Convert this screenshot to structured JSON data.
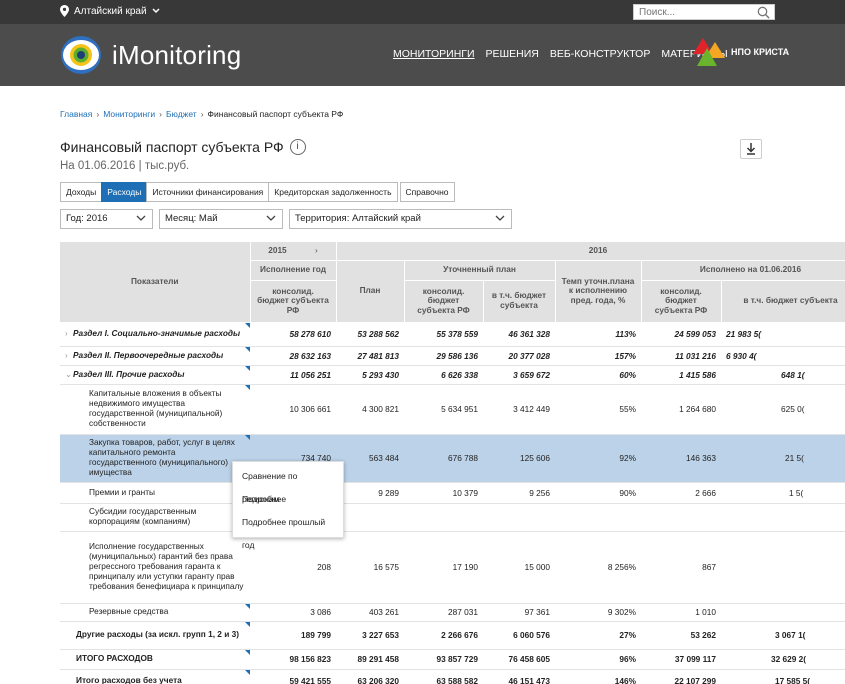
{
  "topbar": {
    "region": "Алтайский край",
    "search_placeholder": "Поиск..."
  },
  "header": {
    "brand": "iMonitoring",
    "nav": [
      "МОНИТОРИНГИ",
      "РЕШЕНИЯ",
      "ВЕБ-КОНСТРУКТОР",
      "МАТЕРИАЛЫ"
    ],
    "partner": "НПО КРИСТА"
  },
  "breadcrumb": [
    "Главная",
    "Мониторинги",
    "Бюджет",
    "Финансовый паспорт субъекта РФ"
  ],
  "page": {
    "title": "Финансовый паспорт субъекта РФ",
    "info": "i",
    "subtitle": "На 01.06.2016 | тыс.руб."
  },
  "tabs": [
    "Доходы",
    "Расходы",
    "Источники финансирования",
    "Кредиторская задолженность",
    "Справочно"
  ],
  "filters": {
    "year": "Год: 2016",
    "month": "Месяц: Май",
    "territory": "Территория: Алтайский край"
  },
  "table": {
    "head_indicators": "Показатели",
    "year_prev": "2015",
    "year_cur": "2016",
    "col_exec_year": "Исполнение год",
    "col_plan": "План",
    "col_refined": "Уточненный план",
    "col_rate": "Темп уточн.плана к исполнению пред. года, %",
    "col_executed": "Исполнено на 01.06.2016",
    "sub_consol": "консолид. бюджет субъекта РФ",
    "sub_subject": "в т.ч. бюджет субъекта",
    "rows": [
      {
        "label": "Раздел I. Социально-значимые расходы",
        "v": [
          "58 278 610",
          "53 288 562",
          "55 378 559",
          "46 361 328",
          "113%",
          "24 599 053",
          "21 983 5("
        ]
      },
      {
        "label": "Раздел II. Первоочередные расходы",
        "v": [
          "28 632 163",
          "27 481 813",
          "29 586 136",
          "20 377 028",
          "157%",
          "11 031 216",
          "6 930 4("
        ]
      },
      {
        "label": "Раздел III. Прочие расходы",
        "v": [
          "11 056 251",
          "5 293 430",
          "6 626 338",
          "3 659 672",
          "60%",
          "1 415 586",
          "648 1("
        ]
      },
      {
        "label": "Капитальные вложения в объекты недвижимого имущества государственной (муниципальной) собственности",
        "v": [
          "10 306 661",
          "4 300 821",
          "5 634 951",
          "3 412 449",
          "55%",
          "1 264 680",
          "625 0("
        ]
      },
      {
        "label": "Закупка товаров, работ, услуг в целях капитального ремонта государственного (муниципального) имущества",
        "v": [
          "734 740",
          "563 484",
          "676 788",
          "125 606",
          "92%",
          "146 363",
          "21 5("
        ]
      },
      {
        "label": "Премии и гранты",
        "v": [
          "",
          "9 289",
          "10 379",
          "9 256",
          "90%",
          "2 666",
          "1 5("
        ]
      },
      {
        "label": "Субсидии государственным корпорациям (компаниям)",
        "v": [
          "",
          "",
          "",
          "",
          "",
          "",
          ""
        ]
      },
      {
        "label": "Исполнение государственных (муниципальных) гарантий без права регрессного требования гаранта к принципалу или уступки гаранту прав требования бенефициара к принципалу",
        "v": [
          "208",
          "16 575",
          "17 190",
          "15 000",
          "8 256%",
          "867",
          ""
        ]
      },
      {
        "label": "Резервные средства",
        "v": [
          "3 086",
          "403 261",
          "287 031",
          "97 361",
          "9 302%",
          "1 010",
          ""
        ]
      },
      {
        "label": "Другие расходы (за искл. групп 1, 2 и 3)",
        "v": [
          "189 799",
          "3 227 653",
          "2 266 676",
          "6 060 576",
          "27%",
          "53 262",
          "3 067 1("
        ]
      },
      {
        "label": "ИТОГО РАСХОДОВ",
        "v": [
          "98 156 823",
          "89 291 458",
          "93 857 729",
          "76 458 605",
          "96%",
          "37 099 117",
          "32 629 2("
        ]
      },
      {
        "label": "Итого расходов без учета",
        "v": [
          "59 421 555",
          "63 206 320",
          "63 588 582",
          "46 151 473",
          "146%",
          "22 107 299",
          "17 585 5("
        ]
      }
    ]
  },
  "context_menu": [
    "Сравнение по регионам",
    "Подробнее",
    "Подробнее прошлый год"
  ],
  "colors": {
    "accent": "#1e6fb5",
    "header": "#4c4c4c",
    "selected_row": "#bcd2e8"
  }
}
